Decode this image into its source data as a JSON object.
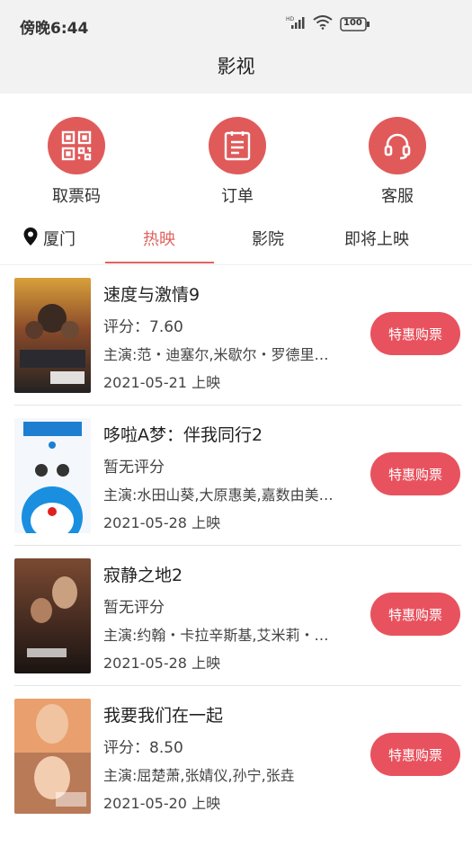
{
  "status": {
    "time": "傍晚6:44",
    "battery": "100"
  },
  "header": {
    "title": "影视"
  },
  "quick_actions": [
    {
      "label": "取票码",
      "icon": "qr-code-icon"
    },
    {
      "label": "订单",
      "icon": "order-list-icon"
    },
    {
      "label": "客服",
      "icon": "headset-icon"
    }
  ],
  "tabs": {
    "location": "厦门",
    "items": [
      "热映",
      "影院",
      "即将上映"
    ],
    "active": "热映"
  },
  "movies": [
    {
      "title": "速度与激情9",
      "score": "评分：7.60",
      "cast": "主演:范・迪塞尔,米歇尔・罗德里…",
      "date": "2021-05-21 上映",
      "button": "特惠购票"
    },
    {
      "title": "哆啦A梦：伴我同行2",
      "score": "暂无评分",
      "cast": "主演:水田山葵,大原惠美,嘉数由美…",
      "date": "2021-05-28 上映",
      "button": "特惠购票"
    },
    {
      "title": "寂静之地2",
      "score": "暂无评分",
      "cast": "主演:约翰・卡拉辛斯基,艾米莉・…",
      "date": "2021-05-28 上映",
      "button": "特惠购票"
    },
    {
      "title": "我要我们在一起",
      "score": "评分：8.50",
      "cast": "主演:屈楚萧,张婧仪,孙宁,张垚",
      "date": "2021-05-20 上映",
      "button": "特惠购票"
    }
  ],
  "colors": {
    "accent": "#e05a5a",
    "button": "#e8525e",
    "tab_active": "#e0635f"
  }
}
